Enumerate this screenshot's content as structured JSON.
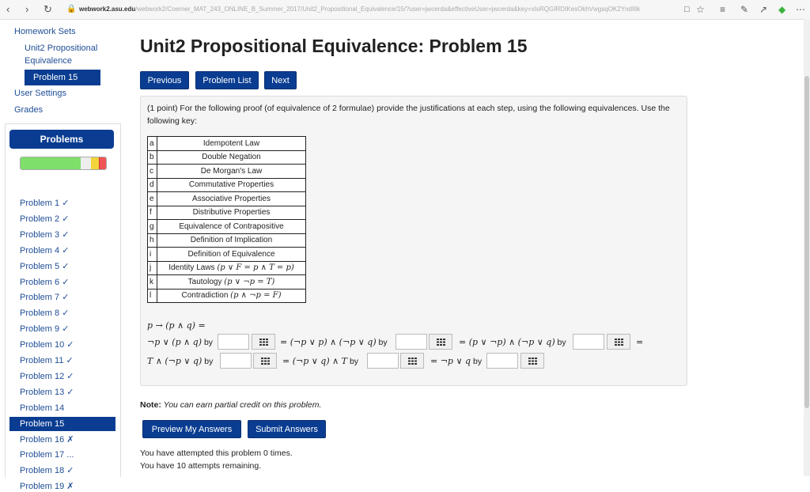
{
  "browser": {
    "url_host": "webwork2.asu.edu",
    "url_rest": "/webwork2/Coerner_MAT_243_ONLINE_B_Summer_2017/Unit2_Propositional_Equivalence/15/?user=jwcerda&effectiveUser=jwcerda&key=xIsRQGIRDIKesOkhVwgsqOK2YndIlIk",
    "back_icon": "back-arrow-icon",
    "forward_icon": "forward-arrow-icon",
    "refresh_icon": "refresh-icon",
    "lock_icon": "lock-icon"
  },
  "sidebar": {
    "homework_sets": "Homework Sets",
    "unit_line1": "Unit2 Propositional",
    "unit_line2": "Equivalence",
    "current_problem": "Problem 15",
    "user_settings": "User Settings",
    "grades": "Grades"
  },
  "problems_panel": {
    "title": "Problems",
    "progress": {
      "correct_fraction": 0.7,
      "partial_fraction": 0.09,
      "incorrect_fraction": 0.08
    },
    "items": [
      {
        "label": "Problem 1 ✓"
      },
      {
        "label": "Problem 2 ✓"
      },
      {
        "label": "Problem 3 ✓"
      },
      {
        "label": "Problem 4 ✓"
      },
      {
        "label": "Problem 5 ✓"
      },
      {
        "label": "Problem 6 ✓"
      },
      {
        "label": "Problem 7 ✓"
      },
      {
        "label": "Problem 8 ✓"
      },
      {
        "label": "Problem 9 ✓"
      },
      {
        "label": "Problem 10 ✓"
      },
      {
        "label": "Problem 11 ✓"
      },
      {
        "label": "Problem 12 ✓"
      },
      {
        "label": "Problem 13 ✓"
      },
      {
        "label": "Problem 14"
      },
      {
        "label": "Problem 15"
      },
      {
        "label": "Problem 16 ✗"
      },
      {
        "label": "Problem 17 ..."
      },
      {
        "label": "Problem 18 ✓"
      },
      {
        "label": "Problem 19 ✗"
      }
    ]
  },
  "main": {
    "title": "Unit2 Propositional Equivalence: Problem 15",
    "buttons": {
      "previous": "Previous",
      "problem_list": "Problem List",
      "next": "Next"
    },
    "intro": "(1 point) For the following proof (of equivalence of 2 formulae) provide the justifications at each step, using the following equivalences. Use the following key:",
    "key": [
      {
        "k": "a",
        "v": "Idempotent Law"
      },
      {
        "k": "b",
        "v": "Double Negation"
      },
      {
        "k": "c",
        "v": "De Morgan's Law"
      },
      {
        "k": "d",
        "v": "Commutative Properties"
      },
      {
        "k": "e",
        "v": "Associative Properties"
      },
      {
        "k": "f",
        "v": "Distributive Properties"
      },
      {
        "k": "g",
        "v": "Equivalence of Contrapositive"
      },
      {
        "k": "h",
        "v": "Definition of Implication"
      },
      {
        "k": "i",
        "v": "Definition of Equivalence"
      },
      {
        "k": "j",
        "v": "Identity Laws",
        "math": "(p ∨ F = p ∧ T = p)"
      },
      {
        "k": "k",
        "v": "Tautology",
        "math": "(p ∨ ¬p = T)"
      },
      {
        "k": "l",
        "v": "Contradiction",
        "math": "(p ∧ ¬p = F)"
      }
    ],
    "proof": {
      "start": "p → (p ∧ q) =",
      "e1": "¬p ∨ (p ∧ q)",
      "e2": "= (¬p ∨ p) ∧ (¬p ∨ q)",
      "e3": "= (p ∨ ¬p) ∧ (¬p ∨ q)",
      "eq": "=",
      "e4": "T ∧ (¬p ∨ q)",
      "e5": "= (¬p ∨ q) ∧ T",
      "e6": "= ¬p ∨ q",
      "by": "by"
    },
    "note_label": "Note:",
    "note_text": "You can earn partial credit on this problem.",
    "preview_button": "Preview My Answers",
    "submit_button": "Submit Answers",
    "attempts": "You have attempted this problem 0 times.",
    "remaining": "You have 10 attempts remaining."
  }
}
